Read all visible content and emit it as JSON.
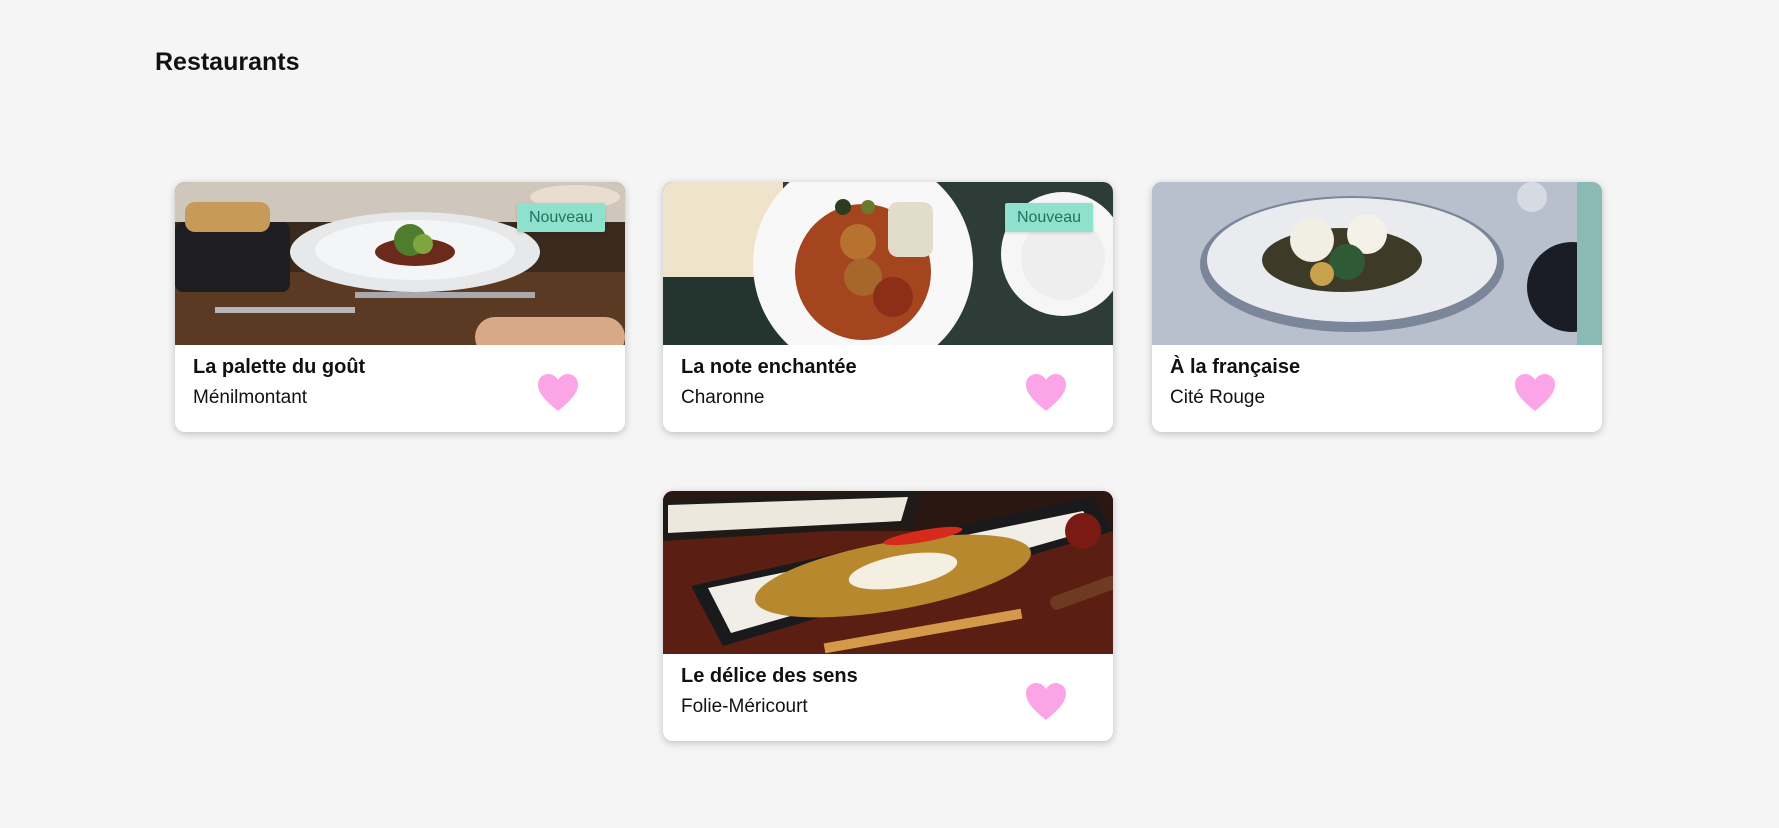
{
  "page": {
    "title": "Restaurants"
  },
  "colors": {
    "background": "#f5f5f5",
    "badge": "#8ee1cd",
    "heart": "#fba4e6"
  },
  "restaurants": [
    {
      "name": "La palette du goût",
      "area": "Ménilmontant",
      "badge": "Nouveau",
      "icon": "heart-icon"
    },
    {
      "name": "La note enchantée",
      "area": "Charonne",
      "badge": "Nouveau",
      "icon": "heart-icon"
    },
    {
      "name": "À la française",
      "area": "Cité Rouge",
      "badge": "",
      "icon": "heart-icon"
    },
    {
      "name": "Le délice des sens",
      "area": "Folie-Méricourt",
      "badge": "",
      "icon": "heart-icon"
    }
  ]
}
